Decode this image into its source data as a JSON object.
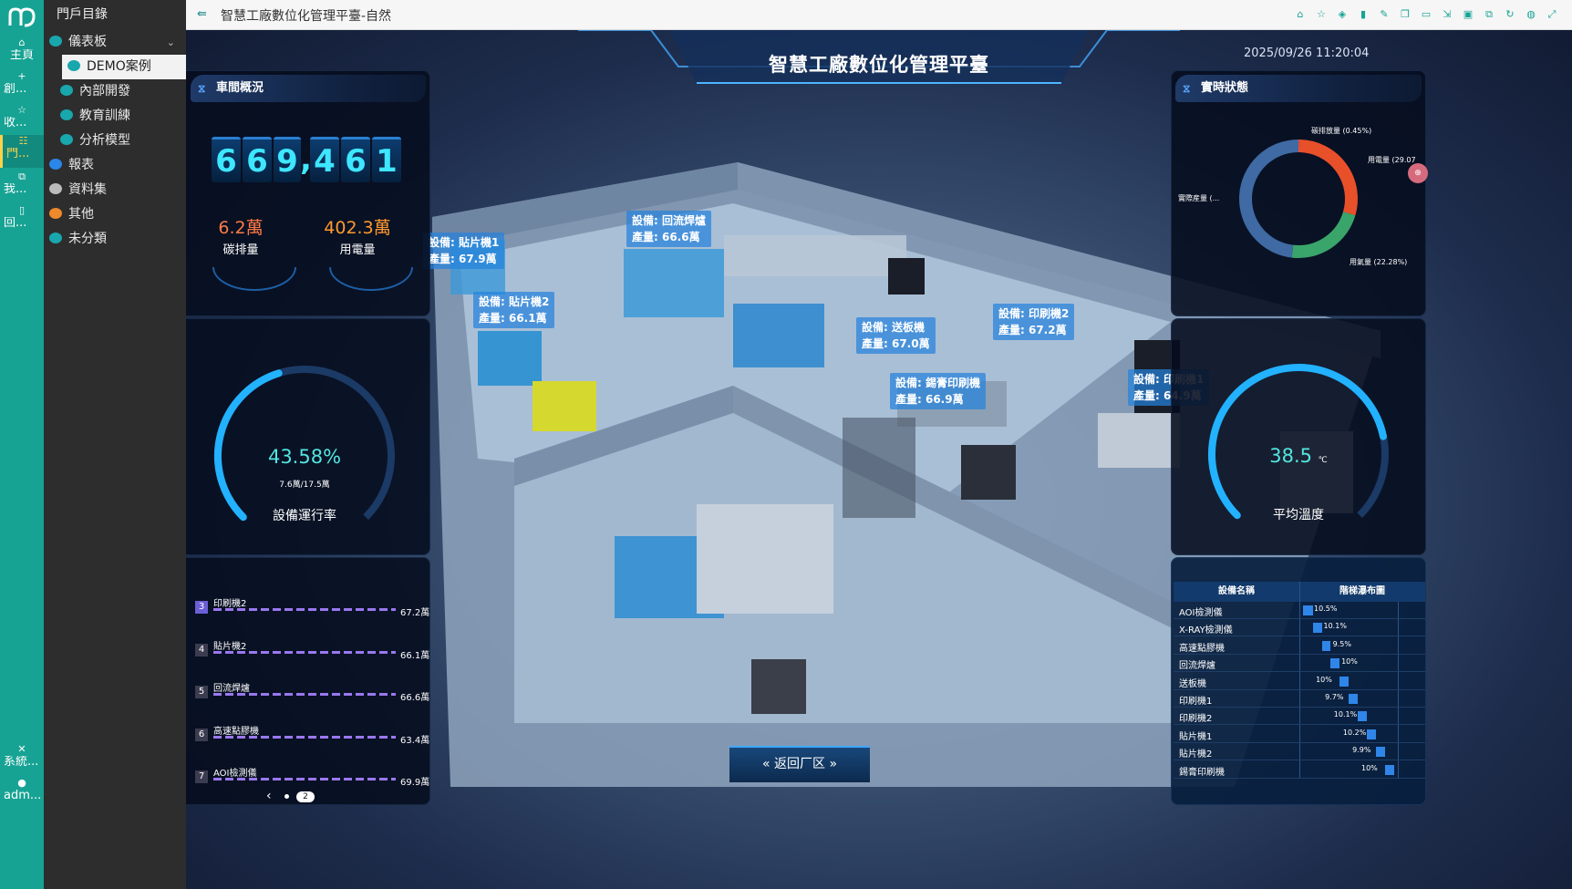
{
  "rail": {
    "items": [
      {
        "icon": "home-icon",
        "glyph": "⌂",
        "label": "主頁"
      },
      {
        "icon": "plus-icon",
        "glyph": "+",
        "label": "創..."
      },
      {
        "icon": "star-icon",
        "glyph": "☆",
        "label": "收..."
      },
      {
        "icon": "tree-icon",
        "glyph": "☷",
        "label": "門..."
      },
      {
        "icon": "share-icon",
        "glyph": "⧉",
        "label": "我..."
      },
      {
        "icon": "trash-icon",
        "glyph": "🗑",
        "label": "回..."
      },
      {
        "icon": "tools-icon",
        "glyph": "✕",
        "label": "系統..."
      },
      {
        "icon": "user-icon",
        "glyph": "●",
        "label": "adm..."
      }
    ]
  },
  "sidebar": {
    "title": "門戶目錄",
    "items": [
      {
        "label": "儀表板"
      },
      {
        "label": "DEMO案例"
      },
      {
        "label": "內部開發"
      },
      {
        "label": "教育訓練"
      },
      {
        "label": "分析模型"
      },
      {
        "label": "報表"
      },
      {
        "label": "資料集"
      },
      {
        "label": "其他"
      },
      {
        "label": "未分類"
      }
    ]
  },
  "topbar": {
    "back_glyph": "⇚",
    "title": "智慧工廠數位化管理平臺-自然"
  },
  "dashboard": {
    "title": "智慧工廠數位化管理平臺",
    "datetime": "2025/09/26 11:20:04",
    "workshop": {
      "title": "車間概況",
      "digits": [
        "6",
        "6",
        "9",
        "4",
        "6",
        "1"
      ],
      "comma": ",",
      "carbon": {
        "value": "6.2萬",
        "label": "碳排量"
      },
      "power": {
        "value": "402.3萬",
        "label": "用電量"
      }
    },
    "gauge_run": {
      "percent": 43.58,
      "percent_text": "43.58%",
      "sub": "7.6萬/17.5萬",
      "label": "設備運行率"
    },
    "rank": {
      "rows": [
        {
          "no": "3",
          "name": "印刷機2",
          "value": "67.2萬"
        },
        {
          "no": "4",
          "name": "貼片機2",
          "value": "66.1萬"
        },
        {
          "no": "5",
          "name": "回流焊爐",
          "value": "66.6萬"
        },
        {
          "no": "6",
          "name": "高速點膠機",
          "value": "63.4萬"
        },
        {
          "no": "7",
          "name": "AOI檢測儀",
          "value": "69.9萬"
        }
      ],
      "pager_prev": "‹",
      "pager_page": "2"
    },
    "realtime": {
      "title": "實時狀態",
      "slices": [
        {
          "label": "碳排放量 (0.45%)",
          "value": 0.45,
          "color": "#f04b3c"
        },
        {
          "label": "用電量 (29.07",
          "value": 29.07,
          "color": "#e8502a"
        },
        {
          "label": "用氣量 (22.28%)",
          "value": 22.28,
          "color": "#3aa56a"
        },
        {
          "label": "實際産量 (...",
          "value": 48.2,
          "color": "#3f6aa3"
        }
      ]
    },
    "gauge_temp": {
      "value": "38.5",
      "unit": "℃",
      "label": "平均溫度",
      "fraction": 0.79
    },
    "table": {
      "col1": "設備名稱",
      "col2": "階梯瀑布圖",
      "rows": [
        {
          "name": "AOI檢測儀",
          "pct": "10.5%",
          "start": 0,
          "len": 10.5
        },
        {
          "name": "X-RAY檢測儀",
          "pct": "10.1%",
          "start": 10.5,
          "len": 10.1
        },
        {
          "name": "高速點膠機",
          "pct": "9.5%",
          "start": 20.6,
          "len": 9.5
        },
        {
          "name": "回流焊爐",
          "pct": "10%",
          "start": 30.1,
          "len": 10
        },
        {
          "name": "送板機",
          "pct": "10%",
          "start": 40.1,
          "len": 10
        },
        {
          "name": "印刷機1",
          "pct": "9.7%",
          "start": 50.1,
          "len": 9.7
        },
        {
          "name": "印刷機2",
          "pct": "10.1%",
          "start": 59.8,
          "len": 10.1
        },
        {
          "name": "貼片機1",
          "pct": "10.2%",
          "start": 69.9,
          "len": 10.2
        },
        {
          "name": "貼片機2",
          "pct": "9.9%",
          "start": 80.1,
          "len": 9.9
        },
        {
          "name": "錫膏印刷機",
          "pct": "10%",
          "start": 90,
          "len": 10
        }
      ]
    },
    "labels3d": [
      {
        "device": "設備: 貼片機1",
        "output": "產量: 67.9萬"
      },
      {
        "device": "設備: 回流焊爐",
        "output": "產量: 66.6萬"
      },
      {
        "device": "設備: 貼片機2",
        "output": "產量: 66.1萬"
      },
      {
        "device": "設備: 送板機",
        "output": "產量: 67.0萬"
      },
      {
        "device": "設備: 印刷機2",
        "output": "產量: 67.2萬"
      },
      {
        "device": "設備: 錫膏印刷機",
        "output": "產量: 66.9萬"
      },
      {
        "device": "設備: 印刷機1",
        "output": "產量: 64.9萬"
      }
    ],
    "back_button": "返回厂区"
  }
}
